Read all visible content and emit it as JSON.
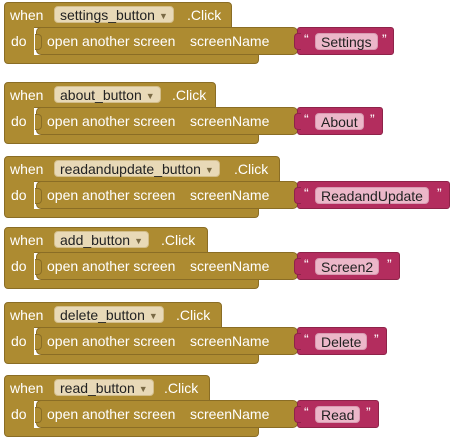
{
  "labels": {
    "when": "when",
    "do": "do",
    "click": ".Click",
    "open_screen": "open another screen",
    "screen_name": "screenName",
    "quote_open": "“",
    "quote_close": "”"
  },
  "blocks": [
    {
      "component": "settings_button",
      "screen": "Settings"
    },
    {
      "component": "about_button",
      "screen": "About"
    },
    {
      "component": "readandupdate_button",
      "screen": "ReadandUpdate"
    },
    {
      "component": "add_button",
      "screen": "Screen2"
    },
    {
      "component": "delete_button",
      "screen": "Delete"
    },
    {
      "component": "read_button",
      "screen": "Read"
    }
  ],
  "icons": {
    "dropdown": "chevron-down-icon"
  },
  "colors": {
    "event_block": "#ad8b31",
    "text_block": "#b32d5e"
  }
}
